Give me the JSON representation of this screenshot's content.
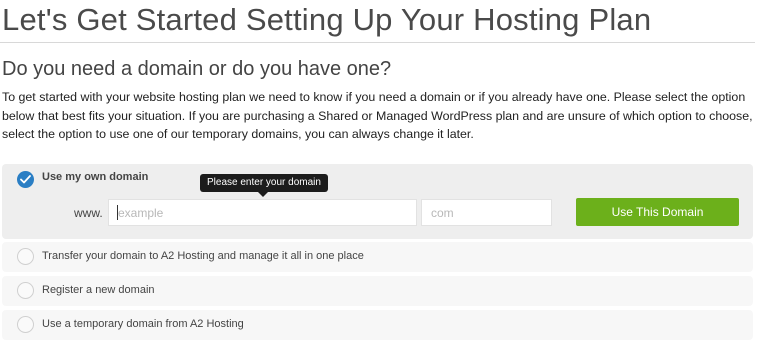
{
  "page": {
    "title": "Let's Get Started Setting Up Your Hosting Plan",
    "heading": "Do you need a domain or do you have one?",
    "intro": "To get started with your website hosting plan we need to know if you need a domain or if you already have one. Please select the option below that best fits your situation. If you are purchasing a Shared or Managed WordPress plan and are unsure of which option to choose, select the option to use one of our temporary domains, you can always change it later."
  },
  "options": [
    {
      "label": "Use my own domain",
      "selected": true
    },
    {
      "label": "Transfer your domain to A2 Hosting and manage it all in one place",
      "selected": false
    },
    {
      "label": "Register a new domain",
      "selected": false
    },
    {
      "label": "Use a temporary domain from A2 Hosting",
      "selected": false
    }
  ],
  "domain_form": {
    "prefix": "www.",
    "domain_placeholder": "example",
    "domain_value": "",
    "tld_placeholder": "com",
    "tld_value": "",
    "button_label": "Use This Domain",
    "tooltip": "Please enter your domain"
  },
  "colors": {
    "accent_blue": "#2a7ec4",
    "button_green": "#6cb01b",
    "tooltip_bg": "#1c1c1c"
  },
  "icons": {
    "selected_radio": "checkmark-icon",
    "unselected_radio": "radio-empty-icon"
  }
}
